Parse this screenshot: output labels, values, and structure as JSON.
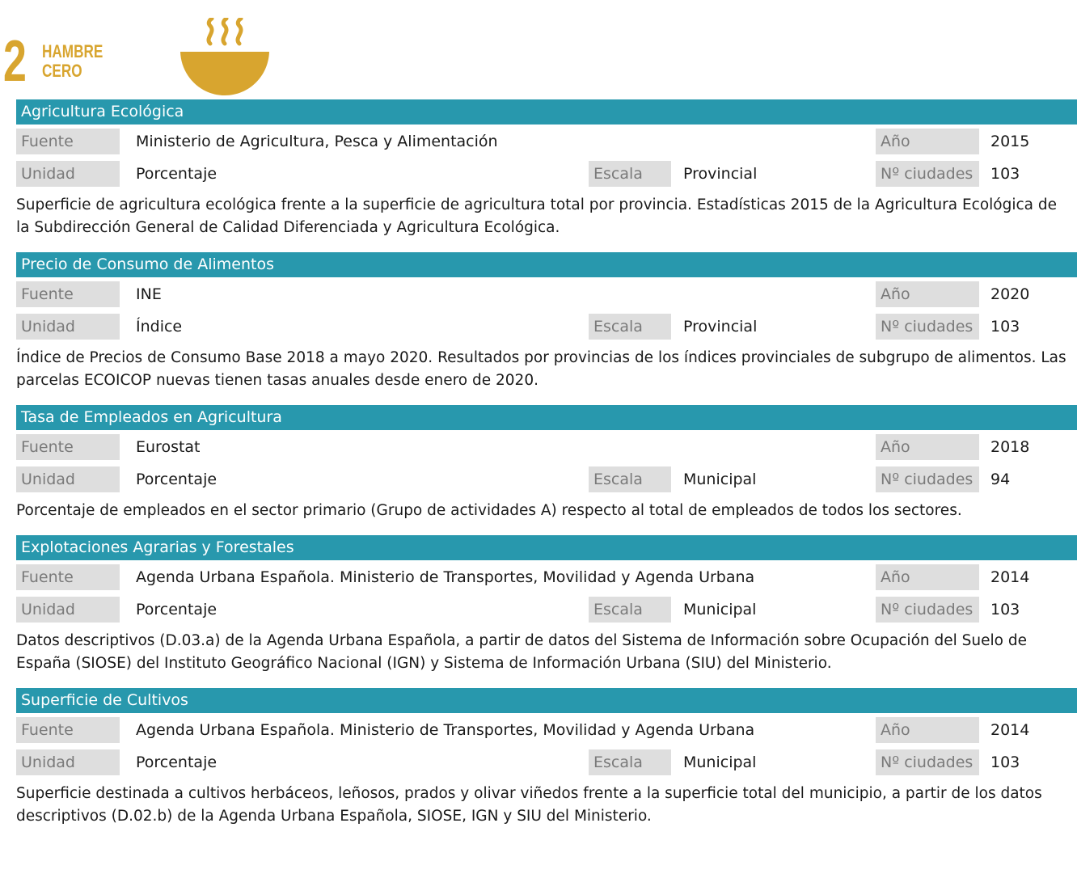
{
  "goal": {
    "number": "2",
    "title_line1": "HAMBRE",
    "title_line2": "CERO",
    "icon": "bowl-steam-icon",
    "color": "#d8a52f"
  },
  "accent_color": "#2898ad",
  "labels": {
    "fuente": "Fuente",
    "unidad": "Unidad",
    "escala": "Escala",
    "anio": "Año",
    "ciudades": "Nº ciudades"
  },
  "sections": [
    {
      "title": "Agricultura Ecológica",
      "fuente": "Ministerio de Agricultura, Pesca y Alimentación",
      "anio": "2015",
      "unidad": "Porcentaje",
      "escala": "Provincial",
      "ciudades": "103",
      "descripcion": "Superficie de agricultura ecológica frente a la superficie de agricultura total por provincia. Estadísticas 2015 de la Agricultura Ecológica de la Subdirección General de Calidad Diferenciada y Agricultura Ecológica."
    },
    {
      "title": "Precio de Consumo de Alimentos",
      "fuente": "INE",
      "anio": "2020",
      "unidad": "Índice",
      "escala": "Provincial",
      "ciudades": "103",
      "descripcion": "Índice de Precios de Consumo Base 2018 a mayo 2020. Resultados por provincias de los índices provinciales de subgrupo de alimentos. Las parcelas ECOICOP nuevas tienen tasas anuales desde enero de 2020."
    },
    {
      "title": "Tasa de Empleados en Agricultura",
      "fuente": "Eurostat",
      "anio": "2018",
      "unidad": "Porcentaje",
      "escala": "Municipal",
      "ciudades": "94",
      "descripcion": "Porcentaje de empleados en el sector primario (Grupo de actividades A) respecto al total de empleados de todos los sectores."
    },
    {
      "title": "Explotaciones Agrarias y Forestales",
      "fuente": "Agenda Urbana Española. Ministerio de Transportes, Movilidad y Agenda Urbana",
      "anio": "2014",
      "unidad": "Porcentaje",
      "escala": "Municipal",
      "ciudades": "103",
      "descripcion": "Datos descriptivos (D.03.a) de la Agenda Urbana Española, a partir de datos del Sistema de Información sobre Ocupación del Suelo de España (SIOSE) del Instituto Geográfico Nacional (IGN) y Sistema de Información Urbana (SIU) del Ministerio."
    },
    {
      "title": "Superficie de Cultivos",
      "fuente": "Agenda Urbana Española. Ministerio de Transportes, Movilidad y Agenda Urbana",
      "anio": "2014",
      "unidad": "Porcentaje",
      "escala": "Municipal",
      "ciudades": "103",
      "descripcion": "Superficie destinada a cultivos herbáceos, leñosos, prados y olivar viñedos frente a la superficie total del municipio, a partir de los datos descriptivos (D.02.b) de la Agenda Urbana Española, SIOSE, IGN y SIU del Ministerio."
    }
  ]
}
